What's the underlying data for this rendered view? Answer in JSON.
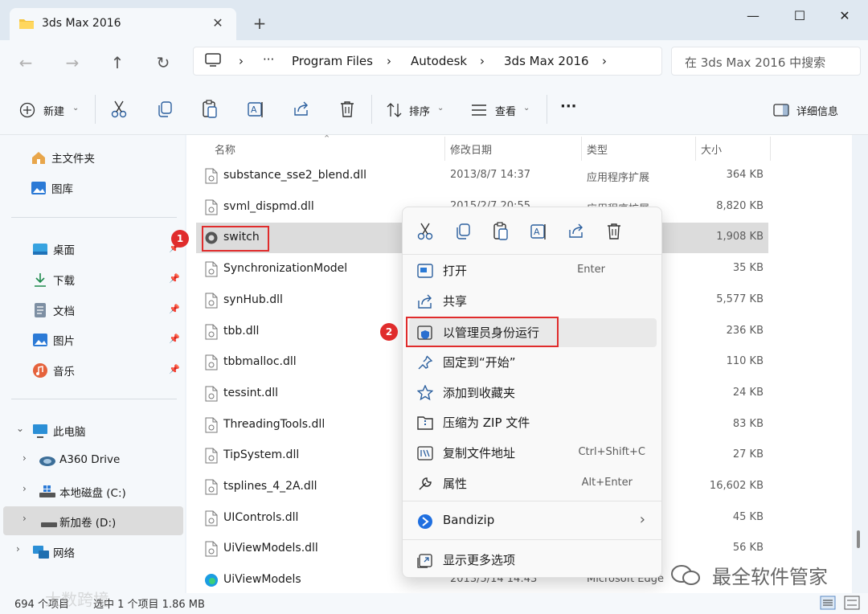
{
  "window": {
    "tab_title": "3ds Max 2016",
    "tab_close": "✕",
    "new_tab": "+",
    "minimize": "—",
    "maximize": "☐",
    "close": "✕"
  },
  "nav": {
    "back": "←",
    "forward": "→",
    "up": "↑",
    "refresh": "↻"
  },
  "breadcrumb": {
    "more": "···",
    "items": [
      "Program Files",
      "Autodesk",
      "3ds Max 2016"
    ],
    "sep": "›"
  },
  "search": {
    "placeholder": "在 3ds Max 2016 中搜索"
  },
  "toolbar": {
    "new_label": "新建",
    "sort_label": "排序",
    "view_label": "查看",
    "more": "···",
    "details_label": "详细信息"
  },
  "sidebar": {
    "home": "主文件夹",
    "gallery": "图库",
    "quick": [
      {
        "label": "桌面",
        "icon": "desktop-icon"
      },
      {
        "label": "下载",
        "icon": "download-icon"
      },
      {
        "label": "文档",
        "icon": "document-icon"
      },
      {
        "label": "图片",
        "icon": "pictures-icon"
      },
      {
        "label": "音乐",
        "icon": "music-icon"
      }
    ],
    "pin": "📌",
    "this_pc": "此电脑",
    "drives": [
      {
        "label": "A360 Drive",
        "icon": "cloud-drive-icon"
      },
      {
        "label": "本地磁盘 (C:)",
        "icon": "windows-drive-icon"
      },
      {
        "label": "新加卷 (D:)",
        "icon": "drive-icon"
      }
    ],
    "network": "网络"
  },
  "columns": {
    "name": "名称",
    "date": "修改日期",
    "type": "类型",
    "size": "大小"
  },
  "files": [
    {
      "name": "substance_sse2_blend.dll",
      "date": "2013/8/7 14:37",
      "type": "应用程序扩展",
      "size": "364 KB"
    },
    {
      "name": "svml_dispmd.dll",
      "date": "2015/2/7 20:55",
      "type": "应用程序扩展",
      "size": "8,820 KB"
    },
    {
      "name": "switch",
      "date": "",
      "type": "",
      "size": "1,908 KB"
    },
    {
      "name": "SynchronizationModel",
      "date": "",
      "type": "",
      "size": "35 KB"
    },
    {
      "name": "synHub.dll",
      "date": "",
      "type": "",
      "size": "5,577 KB"
    },
    {
      "name": "tbb.dll",
      "date": "",
      "type": "",
      "size": "236 KB"
    },
    {
      "name": "tbbmalloc.dll",
      "date": "",
      "type": "",
      "size": "110 KB"
    },
    {
      "name": "tessint.dll",
      "date": "",
      "type": "",
      "size": "24 KB"
    },
    {
      "name": "ThreadingTools.dll",
      "date": "",
      "type": "",
      "size": "83 KB"
    },
    {
      "name": "TipSystem.dll",
      "date": "",
      "type": "",
      "size": "27 KB"
    },
    {
      "name": "tsplines_4_2A.dll",
      "date": "",
      "type": "",
      "size": "16,602 KB"
    },
    {
      "name": "UIControls.dll",
      "date": "",
      "type": "",
      "size": "45 KB"
    },
    {
      "name": "UiViewModels.dll",
      "date": "",
      "type": "",
      "size": "56 KB"
    },
    {
      "name": "UiViewModels",
      "date": "2013/5/14 14:43",
      "type": "Microsoft Edge",
      "size": ""
    }
  ],
  "context_menu": {
    "open": {
      "label": "打开",
      "shortcut": "Enter"
    },
    "share": {
      "label": "共享"
    },
    "run_as_admin": {
      "label": "以管理员身份运行"
    },
    "pin_start": {
      "label": "固定到“开始”"
    },
    "add_favorites": {
      "label": "添加到收藏夹"
    },
    "zip": {
      "label": "压缩为 ZIP 文件"
    },
    "copy_path": {
      "label": "复制文件地址",
      "shortcut": "Ctrl+Shift+C"
    },
    "properties": {
      "label": "属性",
      "shortcut": "Alt+Enter"
    },
    "bandizip": {
      "label": "Bandizip",
      "arrow": "›"
    },
    "more_options": {
      "label": "显示更多选项"
    }
  },
  "annotations": {
    "step1": "1",
    "step2": "2",
    "color": "#e02c2c"
  },
  "status": {
    "count": "694 个项目",
    "selected": "选中 1 个项目  1.86 MB"
  },
  "watermark": {
    "text": "最全软件管家",
    "corner": "大数跨境"
  }
}
